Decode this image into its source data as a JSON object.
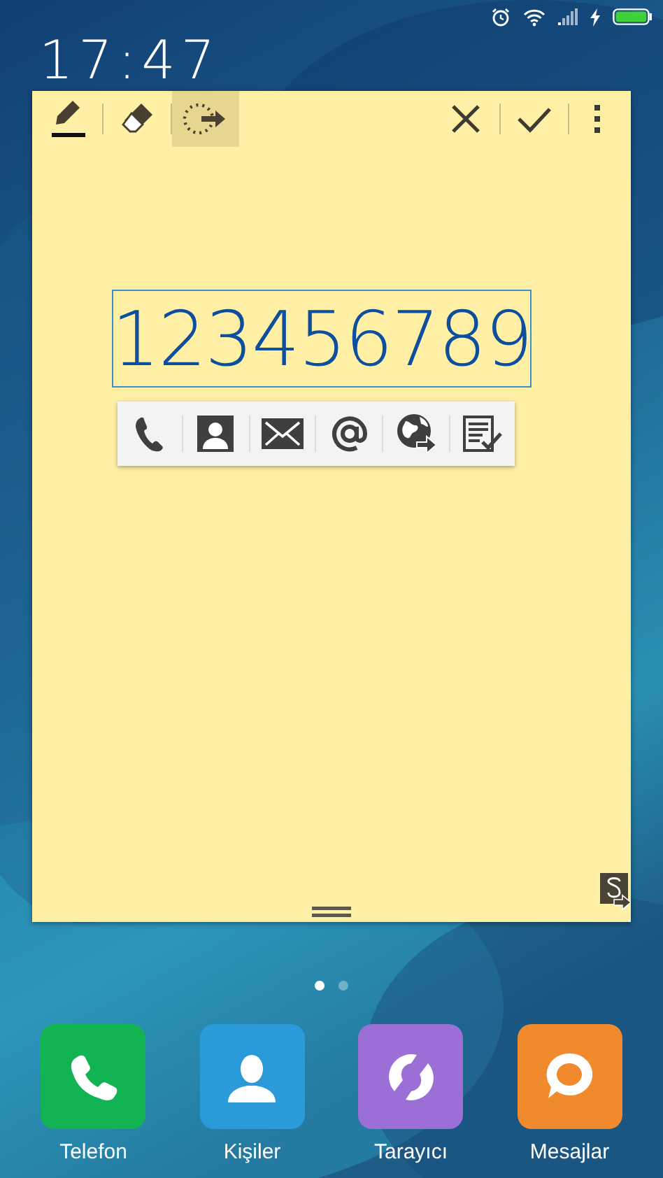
{
  "clock": {
    "time": "17:47"
  },
  "note": {
    "tools": [
      {
        "kind": "pen",
        "selected": false
      },
      {
        "kind": "eraser",
        "selected": false
      },
      {
        "kind": "lasso",
        "selected": true
      }
    ],
    "commands": [
      {
        "kind": "close"
      },
      {
        "kind": "done"
      },
      {
        "kind": "more"
      }
    ],
    "ink": "123456789",
    "actions": [
      {
        "kind": "phone"
      },
      {
        "kind": "contact"
      },
      {
        "kind": "mail"
      },
      {
        "kind": "at"
      },
      {
        "kind": "web"
      },
      {
        "kind": "task"
      }
    ]
  },
  "pages": [
    {
      "selected": true
    },
    {
      "selected": false
    }
  ],
  "dock": [
    {
      "label": "Telefon",
      "kind": "phone",
      "color": "#12b352"
    },
    {
      "label": "Kişiler",
      "kind": "contact",
      "color": "#2a9ad8"
    },
    {
      "label": "Tarayıcı",
      "kind": "browser",
      "color": "#9b6fd6"
    },
    {
      "label": "Mesajlar",
      "kind": "message",
      "color": "#f08a2c"
    }
  ]
}
